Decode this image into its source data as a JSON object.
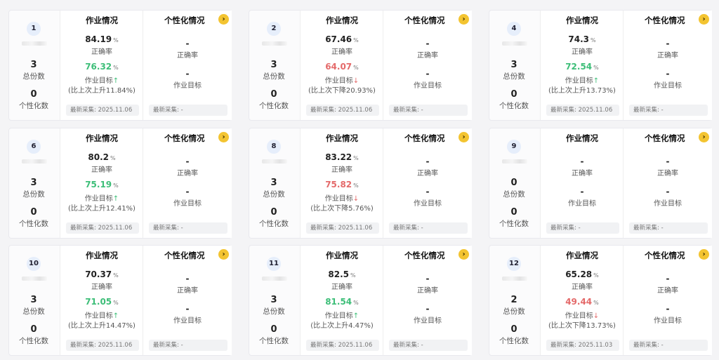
{
  "labels": {
    "homework": "作业情况",
    "personal": "个性化情况",
    "accuracy": "正确率",
    "target": "作业目标",
    "total": "总份数",
    "personal_count": "个性化数",
    "latest": "最新采集",
    "dash": "-"
  },
  "cards": [
    {
      "id": "1",
      "total": "3",
      "personal": "0",
      "accuracy": "84.19",
      "target": "76.32",
      "trend": "up",
      "change": "(比上次上升11.84%)",
      "date": "最新采集: 2025.11.06",
      "p_acc": "-",
      "p_target": "-",
      "p_foot": "最新采集: -"
    },
    {
      "id": "2",
      "total": "3",
      "personal": "0",
      "accuracy": "67.46",
      "target": "64.07",
      "trend": "down",
      "change": "(比上次下降20.93%)",
      "date": "最新采集: 2025.11.06",
      "p_acc": "-",
      "p_target": "-",
      "p_foot": "最新采集: -"
    },
    {
      "id": "4",
      "total": "3",
      "personal": "0",
      "accuracy": "74.3",
      "target": "72.54",
      "trend": "up",
      "change": "(比上次上升13.73%)",
      "date": "最新采集: 2025.11.06",
      "p_acc": "-",
      "p_target": "-",
      "p_foot": "最新采集: -"
    },
    {
      "id": "6",
      "total": "3",
      "personal": "0",
      "accuracy": "80.2",
      "target": "75.19",
      "trend": "up",
      "change": "(比上次上升12.41%)",
      "date": "最新采集: 2025.11.06",
      "p_acc": "-",
      "p_target": "-",
      "p_foot": "最新采集: -"
    },
    {
      "id": "8",
      "total": "3",
      "personal": "0",
      "accuracy": "83.22",
      "target": "75.82",
      "trend": "down",
      "change": "(比上次下降5.76%)",
      "date": "最新采集: 2025.11.06",
      "p_acc": "-",
      "p_target": "-",
      "p_foot": "最新采集: -"
    },
    {
      "id": "9",
      "total": "0",
      "personal": "0",
      "accuracy": "-",
      "target": "-",
      "trend": "none",
      "change": "",
      "date": "最新采集: -",
      "p_acc": "-",
      "p_target": "-",
      "p_foot": "最新采集: -"
    },
    {
      "id": "10",
      "total": "3",
      "personal": "0",
      "accuracy": "70.37",
      "target": "71.05",
      "trend": "up",
      "change": "(比上次上升14.47%)",
      "date": "最新采集: 2025.11.06",
      "p_acc": "-",
      "p_target": "-",
      "p_foot": "最新采集: -"
    },
    {
      "id": "11",
      "total": "3",
      "personal": "0",
      "accuracy": "82.5",
      "target": "81.54",
      "trend": "up",
      "change": "(比上次上升4.47%)",
      "date": "最新采集: 2025.11.06",
      "p_acc": "-",
      "p_target": "-",
      "p_foot": "最新采集: -"
    },
    {
      "id": "12",
      "total": "2",
      "personal": "0",
      "accuracy": "65.28",
      "target": "49.44",
      "trend": "down",
      "change": "(比上次下降13.73%)",
      "date": "最新采集: 2025.11.03",
      "p_acc": "-",
      "p_target": "-",
      "p_foot": "最新采集: -"
    }
  ],
  "colors": {
    "up": "#3dbe78",
    "down": "#e46a6a",
    "accent": "#f3c431"
  },
  "icons": {
    "up": "arrow-up-icon",
    "down": "arrow-down-icon",
    "go": "chevron-right-icon"
  }
}
